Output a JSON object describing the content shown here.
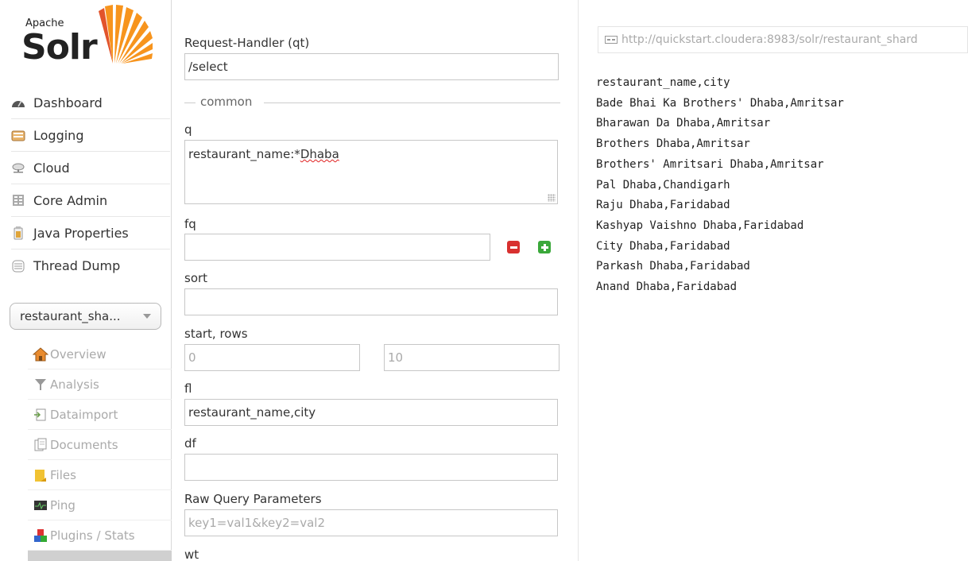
{
  "logo": {
    "apache": "Apache",
    "solr": "Solr"
  },
  "nav": [
    {
      "label": "Dashboard",
      "icon": "dashboard-icon"
    },
    {
      "label": "Logging",
      "icon": "logging-icon"
    },
    {
      "label": "Cloud",
      "icon": "cloud-icon"
    },
    {
      "label": "Core Admin",
      "icon": "core-admin-icon"
    },
    {
      "label": "Java Properties",
      "icon": "java-properties-icon"
    },
    {
      "label": "Thread Dump",
      "icon": "thread-dump-icon"
    }
  ],
  "core_selector": {
    "value": "restaurant_sha..."
  },
  "core_nav": [
    {
      "label": "Overview",
      "icon": "home-icon"
    },
    {
      "label": "Analysis",
      "icon": "filter-icon"
    },
    {
      "label": "Dataimport",
      "icon": "dataimport-icon"
    },
    {
      "label": "Documents",
      "icon": "documents-icon"
    },
    {
      "label": "Files",
      "icon": "folder-icon"
    },
    {
      "label": "Ping",
      "icon": "ping-icon"
    },
    {
      "label": "Plugins / Stats",
      "icon": "plugins-icon"
    },
    {
      "label": "",
      "icon": "query-icon"
    }
  ],
  "form": {
    "qt_label": "Request-Handler (qt)",
    "qt_value": "/select",
    "common_legend": "common",
    "q_label": "q",
    "q_value_field": "restaurant_name:*",
    "q_value_term": "Dhaba",
    "fq_label": "fq",
    "fq_value": "",
    "sort_label": "sort",
    "sort_value": "",
    "start_rows_label": "start, rows",
    "start_placeholder": "0",
    "rows_placeholder": "10",
    "fl_label": "fl",
    "fl_value": "restaurant_name,city",
    "df_label": "df",
    "df_value": "",
    "raw_label": "Raw Query Parameters",
    "raw_placeholder": "key1=val1&key2=val2",
    "wt_label": "wt"
  },
  "results": {
    "url": "http://quickstart.cloudera:8983/solr/restaurant_shard",
    "lines": [
      "restaurant_name,city",
      "Bade Bhai Ka Brothers' Dhaba,Amritsar",
      "Bharawan Da Dhaba,Amritsar",
      "Brothers Dhaba,Amritsar",
      "Brothers' Amritsari Dhaba,Amritsar",
      "Pal Dhaba,Chandigarh",
      "Raju Dhaba,Faridabad",
      "Kashyap Vaishno Dhaba,Faridabad",
      "City Dhaba,Faridabad",
      "Parkash Dhaba,Faridabad",
      "Anand Dhaba,Faridabad"
    ]
  },
  "colors": {
    "remove_button": "#d8302f",
    "add_button": "#3aa83a",
    "logo_orange": "#f7941d"
  }
}
